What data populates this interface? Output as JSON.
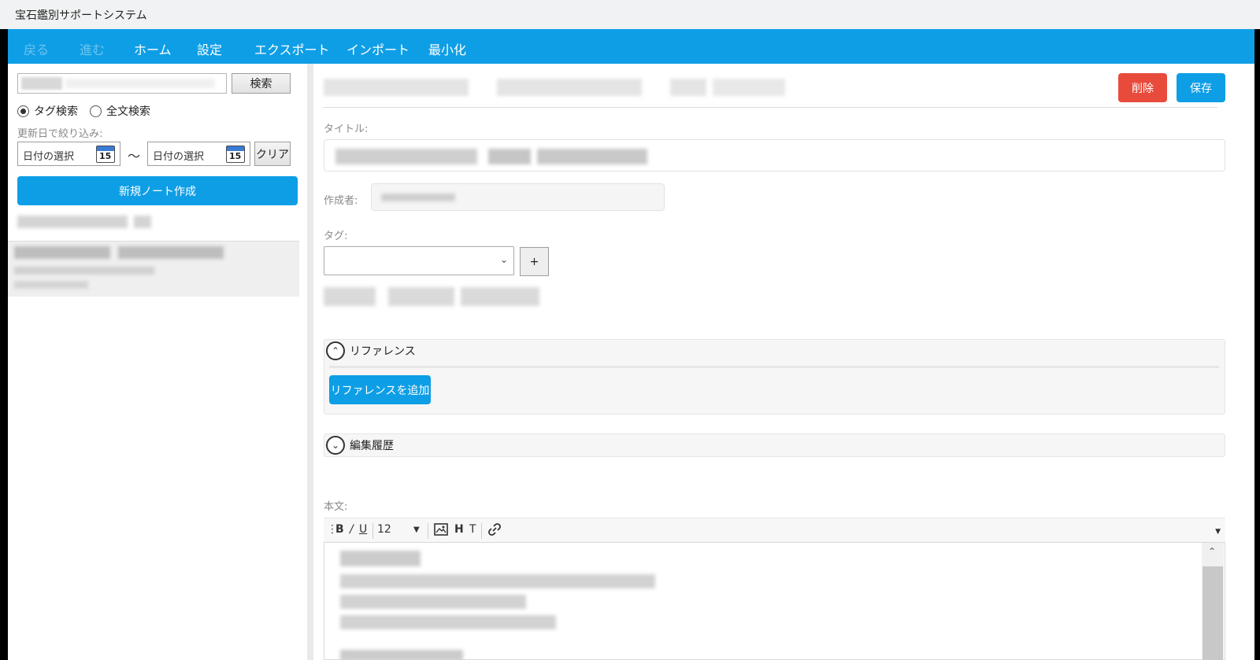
{
  "window": {
    "title": "宝石鑑別サポートシステム"
  },
  "menu": {
    "items": [
      {
        "label": "戻る",
        "enabled": false
      },
      {
        "label": "進む",
        "enabled": false
      },
      {
        "label": "ホーム",
        "enabled": true
      },
      {
        "label": "設定",
        "enabled": true
      },
      {
        "label": "エクスポート",
        "enabled": true
      },
      {
        "label": "インポート",
        "enabled": true
      },
      {
        "label": "最小化",
        "enabled": true
      }
    ]
  },
  "sidebar": {
    "search_button": "検索",
    "radio_tag": "タグ検索",
    "radio_fulltext": "全文検索",
    "filter_label": "更新日で絞り込み:",
    "date_from_placeholder": "日付の選択",
    "date_to_placeholder": "日付の選択",
    "calendar_day": "15",
    "tilde": "～",
    "clear_button": "クリア",
    "new_note_button": "新規ノート作成"
  },
  "editor": {
    "delete_button": "削除",
    "save_button": "保存",
    "title_label": "タイトル:",
    "author_label": "作成者:",
    "tag_label": "タグ:",
    "add_tag_button": "+",
    "reference_panel": {
      "title": "リファレンス",
      "expanded": true,
      "add_button": "リファレンスを追加"
    },
    "history_panel": {
      "title": "編集履歴",
      "expanded": false
    },
    "body_label": "本文:",
    "toolbar": {
      "bold": "B",
      "italic": "/",
      "underline": "U",
      "font_size": "12",
      "heading": "H",
      "text": "T"
    }
  },
  "colors": {
    "accent": "#0e9ee6",
    "danger": "#e84b3c"
  }
}
